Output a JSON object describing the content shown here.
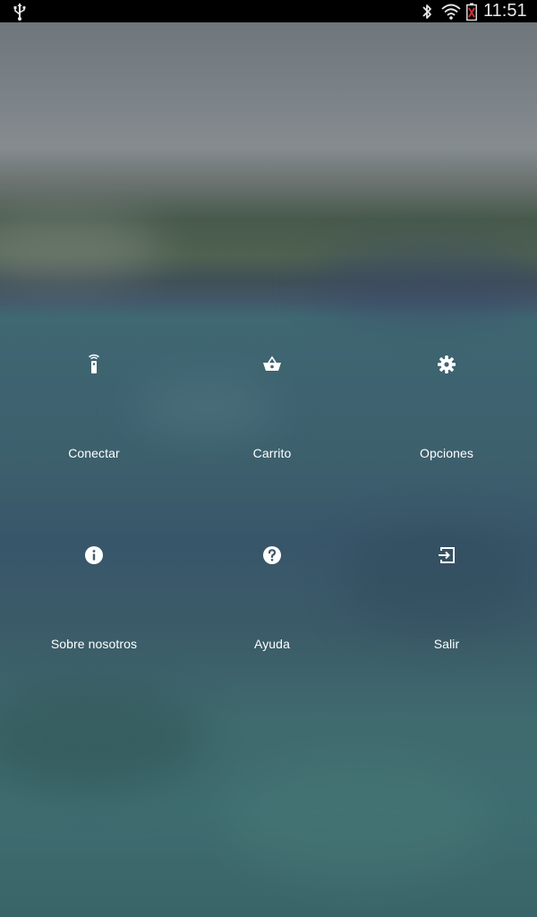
{
  "status_bar": {
    "time": "11:51",
    "icons": [
      "usb-icon",
      "bluetooth-icon",
      "wifi-icon",
      "battery-icon"
    ]
  },
  "menu": {
    "items": [
      {
        "label": "Conectar",
        "icon": "remote-icon"
      },
      {
        "label": "Carrito",
        "icon": "basket-icon"
      },
      {
        "label": "Opciones",
        "icon": "gear-icon"
      },
      {
        "label": "Sobre nosotros",
        "icon": "info-icon"
      },
      {
        "label": "Ayuda",
        "icon": "help-icon"
      },
      {
        "label": "Salir",
        "icon": "exit-icon"
      }
    ]
  },
  "colors": {
    "status_bar_bg": "#000000",
    "label_color": "#ffffff",
    "battery_alert": "#d32f2f"
  }
}
